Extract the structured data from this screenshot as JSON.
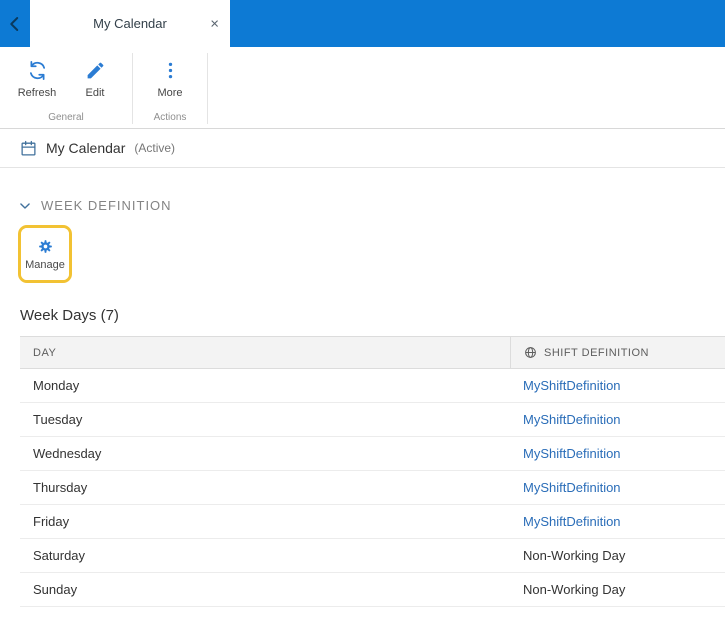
{
  "tab_bar": {
    "tab": {
      "title": "My Calendar",
      "close_glyph": "×"
    }
  },
  "ribbon": {
    "buttons": [
      {
        "label": "Refresh"
      },
      {
        "label": "Edit"
      },
      {
        "label": "More"
      }
    ],
    "groups": [
      "General",
      "Actions"
    ]
  },
  "record": {
    "title": "My Calendar",
    "status": "(Active)"
  },
  "week_definition": {
    "title": "WEEK DEFINITION",
    "manage_label": "Manage"
  },
  "week_days": {
    "title": "Week Days (7)",
    "columns": {
      "day": "DAY",
      "shift": "SHIFT DEFINITION"
    },
    "rows": [
      {
        "day": "Monday",
        "shift": "MyShiftDefinition"
      },
      {
        "day": "Tuesday",
        "shift": "MyShiftDefinition"
      },
      {
        "day": "Wednesday",
        "shift": "MyShiftDefinition"
      },
      {
        "day": "Thursday",
        "shift": "MyShiftDefinition"
      },
      {
        "day": "Friday",
        "shift": "MyShiftDefinition"
      },
      {
        "day": "Saturday",
        "shift": "Non-Working Day"
      },
      {
        "day": "Sunday",
        "shift": "Non-Working Day"
      }
    ]
  },
  "colors": {
    "accent_blue": "#0d7ad4",
    "icon_blue": "#2b7cd3",
    "link_blue": "#2a6db8",
    "highlight_yellow": "#f2c233"
  }
}
